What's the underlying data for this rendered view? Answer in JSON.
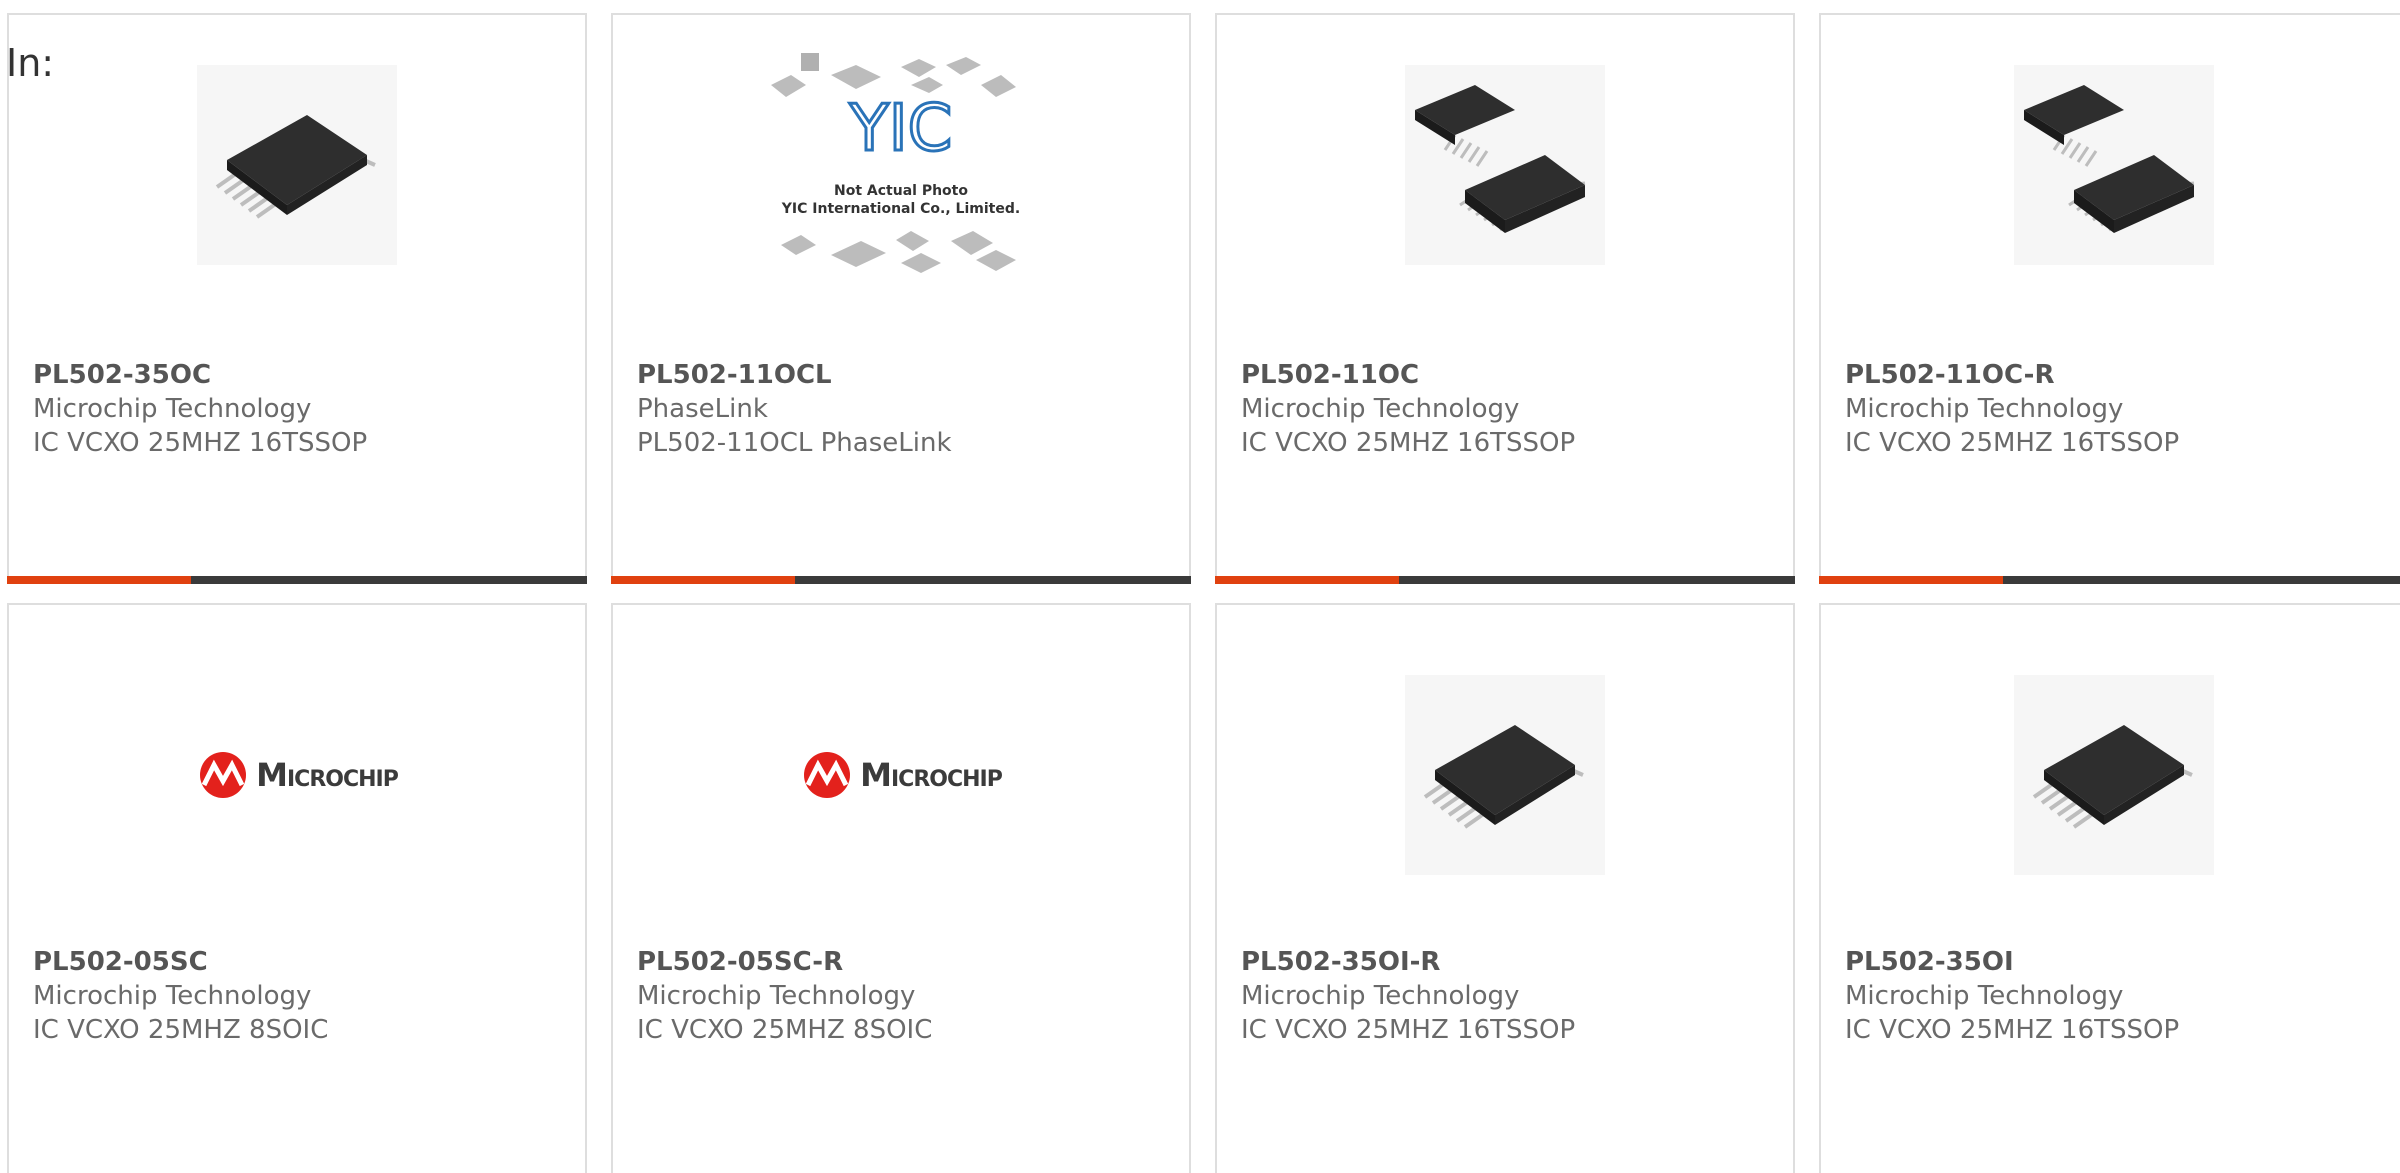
{
  "header": {
    "label": "In:"
  },
  "accent_color": "#e0410f",
  "products": [
    {
      "part": "PL502-35OC",
      "maker": "Microchip Technology",
      "desc": "IC VCXO 25MHZ 16TSSOP",
      "image": "tssop-chip-image"
    },
    {
      "part": "PL502-11OCL",
      "maker": "PhaseLink",
      "desc": "PL502-11OCL PhaseLink",
      "image": "placeholder-image",
      "placeholder_lines": [
        "Not Actual Photo",
        "YIC International Co., Limited."
      ]
    },
    {
      "part": "PL502-11OC",
      "maker": "Microchip Technology",
      "desc": "IC VCXO 25MHZ 16TSSOP",
      "image": "dual-chip-image"
    },
    {
      "part": "PL502-11OC-R",
      "maker": "Microchip Technology",
      "desc": "IC VCXO 25MHZ 16TSSOP",
      "image": "dual-chip-image"
    },
    {
      "part": "PL502-05SC",
      "maker": "Microchip Technology",
      "desc": "IC VCXO 25MHZ 8SOIC",
      "image": "microchip-logo",
      "logo_text": "Microchip"
    },
    {
      "part": "PL502-05SC-R",
      "maker": "Microchip Technology",
      "desc": "IC VCXO 25MHZ 8SOIC",
      "image": "microchip-logo",
      "logo_text": "Microchip"
    },
    {
      "part": "PL502-35OI-R",
      "maker": "Microchip Technology",
      "desc": "IC VCXO 25MHZ 16TSSOP",
      "image": "tssop-chip-image"
    },
    {
      "part": "PL502-35OI",
      "maker": "Microchip Technology",
      "desc": "IC VCXO 25MHZ 16TSSOP",
      "image": "tssop-chip-image"
    }
  ]
}
